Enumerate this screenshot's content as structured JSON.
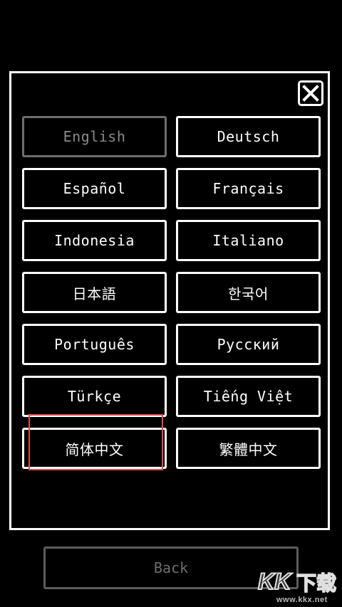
{
  "dialog": {
    "close_icon": "close-x-icon",
    "languages": [
      {
        "label": "English",
        "selected": true
      },
      {
        "label": "Deutsch",
        "selected": false
      },
      {
        "label": "Español",
        "selected": false
      },
      {
        "label": "Français",
        "selected": false
      },
      {
        "label": "Indonesia",
        "selected": false
      },
      {
        "label": "Italiano",
        "selected": false
      },
      {
        "label": "日本語",
        "selected": false
      },
      {
        "label": "한국어",
        "selected": false
      },
      {
        "label": "Português",
        "selected": false
      },
      {
        "label": "Русский",
        "selected": false
      },
      {
        "label": "Türkçe",
        "selected": false
      },
      {
        "label": "Tiếng Việt",
        "selected": false
      },
      {
        "label": "简体中文",
        "selected": false
      },
      {
        "label": "繁體中文",
        "selected": false
      }
    ],
    "highlighted_language": "简体中文"
  },
  "footer": {
    "back_label": "Back"
  },
  "watermark": {
    "logo": "KK下载",
    "url": "www.kkx.net"
  },
  "colors": {
    "background": "#000000",
    "foreground": "#ffffff",
    "selected": "#8a8a8a",
    "disabled": "#6e6e6e",
    "highlight": "#e84a4a"
  }
}
